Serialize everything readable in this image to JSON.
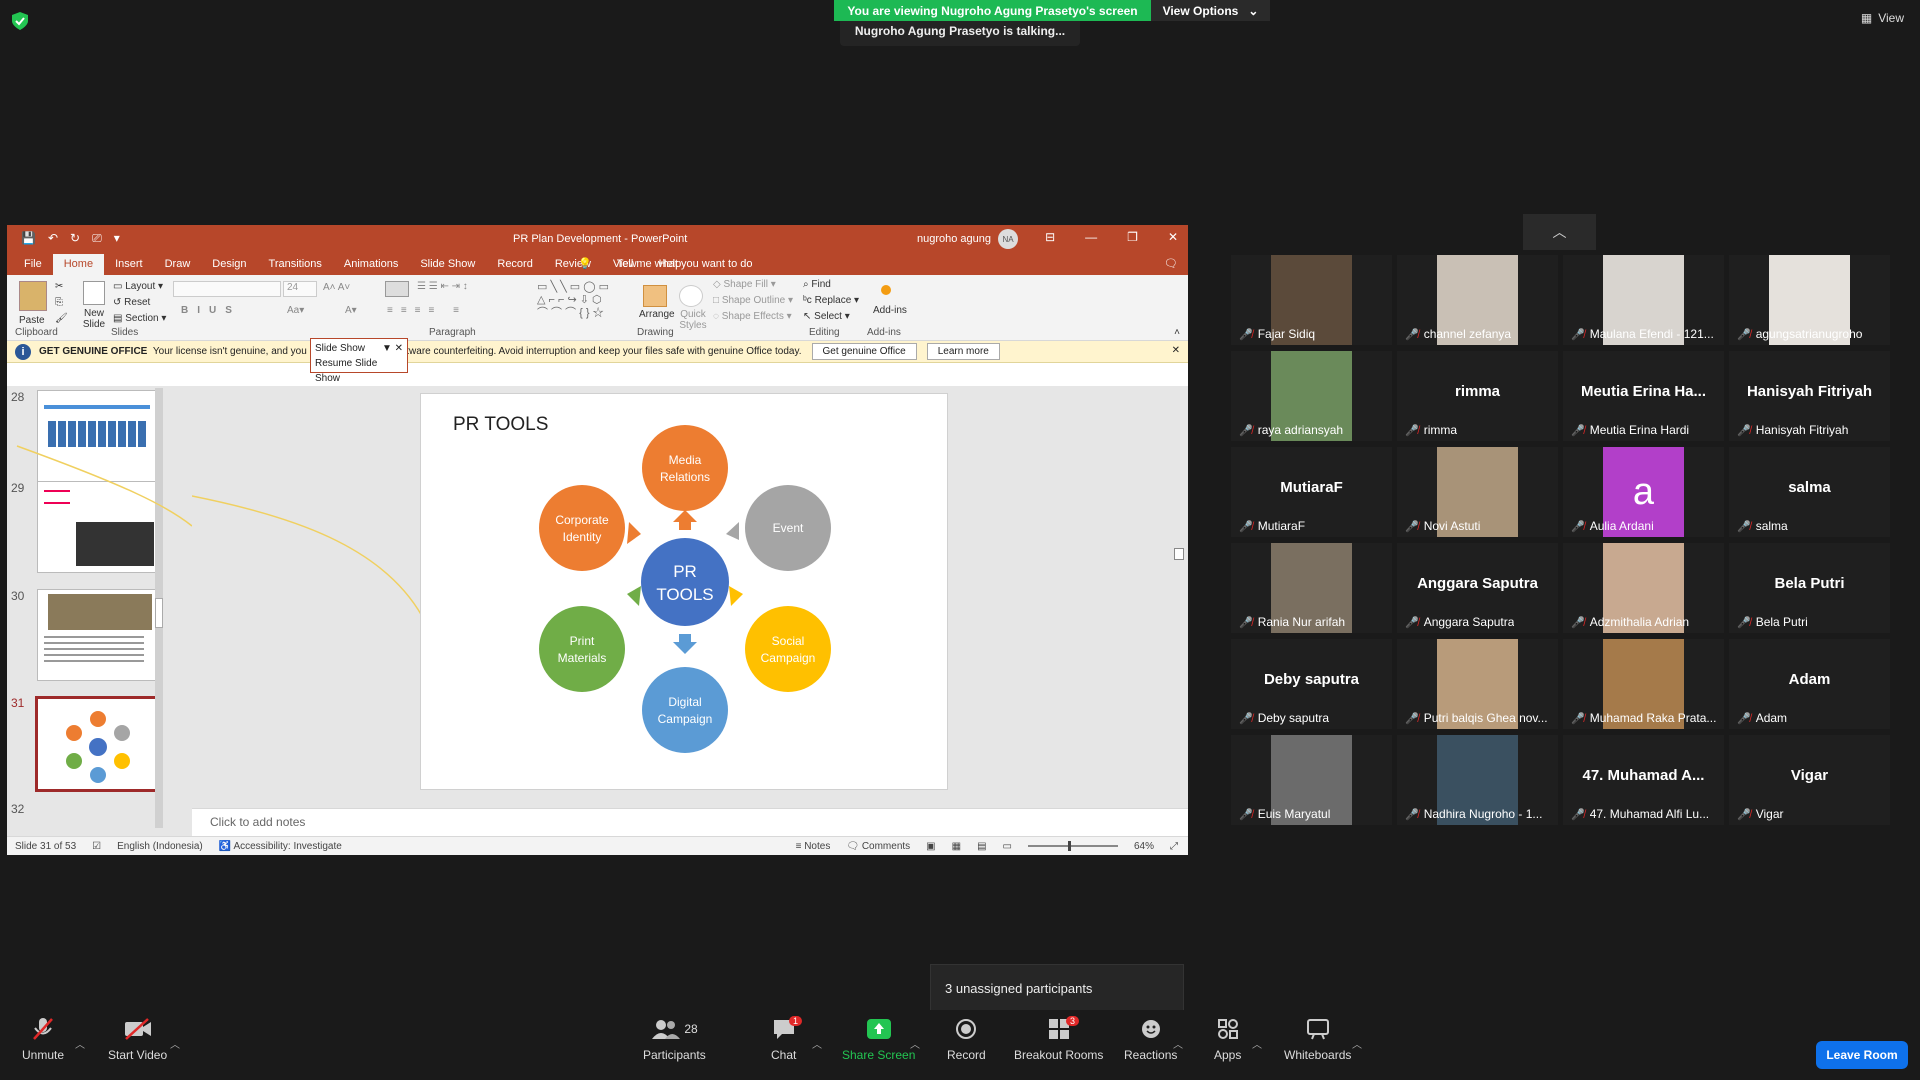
{
  "zoom": {
    "sharing_banner": "You are viewing Nugroho Agung Prasetyo's screen",
    "view_options": "View Options",
    "talking": "Nugroho Agung Prasetyo is talking...",
    "view_label": "View",
    "unassigned": "3 unassigned participants",
    "leave": "Leave Room"
  },
  "toolbar": {
    "unmute": "Unmute",
    "start_video": "Start Video",
    "participants": "Participants",
    "participants_count": "28",
    "chat": "Chat",
    "chat_badge": "1",
    "share": "Share Screen",
    "record": "Record",
    "breakout": "Breakout Rooms",
    "breakout_badge": "3",
    "reactions": "Reactions",
    "apps": "Apps",
    "whiteboards": "Whiteboards"
  },
  "ppt": {
    "title": "PR Plan Development  -  PowerPoint",
    "user": "nugroho agung",
    "user_initials": "NA",
    "tabs": [
      "File",
      "Home",
      "Insert",
      "Draw",
      "Design",
      "Transitions",
      "Animations",
      "Slide Show",
      "Record",
      "Review",
      "View",
      "Help"
    ],
    "tell_me": "Tell me what you want to do",
    "ribbon": {
      "paste": "Paste",
      "new_slide": "New Slide",
      "layout": "Layout",
      "reset": "Reset",
      "section": "Section",
      "font_size": "24",
      "shape_fill": "Shape Fill",
      "shape_outline": "Shape Outline",
      "shape_effects": "Shape Effects",
      "arrange": "Arrange",
      "quick_styles": "Quick Styles",
      "find": "Find",
      "replace": "Replace",
      "select": "Select",
      "addins": "Add-ins",
      "groups": {
        "clipboard": "Clipboard",
        "slides": "Slides",
        "paragraph": "Paragraph",
        "drawing": "Drawing",
        "editing": "Editing",
        "addins": "Add-ins"
      }
    },
    "popup": {
      "title": "Slide Show",
      "item": "Resume Slide Show"
    },
    "warning": {
      "title": "GET GENUINE OFFICE",
      "text": "Your license isn't genuine, and you may be a victim of software counterfeiting. Avoid interruption and keep your files safe with genuine Office today.",
      "btn1": "Get genuine Office",
      "btn2": "Learn more"
    },
    "thumb_numbers": [
      "28",
      "29",
      "30",
      "31",
      "32"
    ],
    "slide": {
      "title": "PR TOOLS",
      "center": "PR\nTOOLS",
      "nodes": [
        "Media Relations",
        "Event",
        "Social Campaign",
        "Digital Campaign",
        "Print Materials",
        "Corporate Identity"
      ]
    },
    "notes": "Click to add notes",
    "status": {
      "slide": "Slide 31 of 53",
      "lang": "English (Indonesia)",
      "accessibility": "Accessibility: Investigate",
      "notes": "Notes",
      "comments": "Comments",
      "zoom": "64%"
    }
  },
  "gallery": [
    {
      "name": "Fajar Sidiq",
      "video": true,
      "color": "#5b4a3a"
    },
    {
      "name": "channel zefanya",
      "video": true,
      "color": "#c9c0b5"
    },
    {
      "name": "Maulana Efendi - 121...",
      "video": true,
      "color": "#d8d4cf"
    },
    {
      "name": "agungsatrianugroho",
      "video": true,
      "color": "#e5e1dc"
    },
    {
      "name": "raya adriansyah",
      "video": true,
      "color": "#6a8a5a"
    },
    {
      "name": "rimma",
      "big": "rimma"
    },
    {
      "name": "Meutia Erina Hardi",
      "big": "Meutia Erina Ha..."
    },
    {
      "name": "Hanisyah Fitriyah",
      "big": "Hanisyah Fitriyah"
    },
    {
      "name": "MutiaraF",
      "big": "MutiaraF"
    },
    {
      "name": "Novi Astuti",
      "video": true,
      "color": "#a89378"
    },
    {
      "name": "Aulia Ardani",
      "avatar": "a"
    },
    {
      "name": "salma",
      "big": "salma"
    },
    {
      "name": "Rania Nur arifah",
      "video": true,
      "color": "#7a6f60"
    },
    {
      "name": "Anggara Saputra",
      "big": "Anggara Saputra"
    },
    {
      "name": "Adzmithalia Adrian",
      "video": true,
      "color": "#c8a990"
    },
    {
      "name": "Bela Putri",
      "big": "Bela Putri"
    },
    {
      "name": "Deby saputra",
      "big": "Deby saputra"
    },
    {
      "name": "Putri balqis Ghea nov...",
      "video": true,
      "color": "#b89b7a"
    },
    {
      "name": "Muhamad Raka Prata...",
      "video": true,
      "color": "#a57a4a"
    },
    {
      "name": "Adam",
      "big": "Adam"
    },
    {
      "name": "Euis Maryatul",
      "video": true,
      "color": "#6b6b6b"
    },
    {
      "name": "Nadhira Nugroho - 1...",
      "video": true,
      "color": "#3a5060"
    },
    {
      "name": "47. Muhamad Alfi Lu...",
      "big": "47. Muhamad A..."
    },
    {
      "name": "Vigar",
      "big": "Vigar"
    }
  ]
}
